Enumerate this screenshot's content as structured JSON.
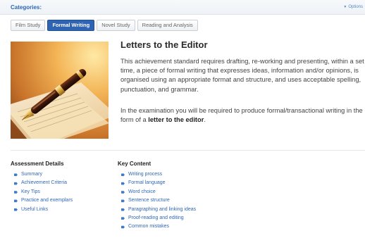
{
  "header": {
    "categories_label": "Categories:",
    "options_label": "Options"
  },
  "tabs": [
    {
      "label": "Film Study"
    },
    {
      "label": "Formal Writing",
      "active": true
    },
    {
      "label": "Novel Study"
    },
    {
      "label": "Reading and Analysis"
    }
  ],
  "article": {
    "title": "Letters to the Editor",
    "paragraph1": "This achievement standard requires drafting, re-working and presenting, within a set time, a piece of formal writing that expresses ideas, information and/or opinions, is organised using an appropriate format and structure, and uses acceptable spelling, punctuation, and grammar.",
    "paragraph2_before": "In the examination you will be required to produce formal/transactional writing in the form of a ",
    "paragraph2_bold": "letter to the editor",
    "paragraph2_after": "."
  },
  "assessment": {
    "heading": "Assessment Details",
    "items": [
      "Summary",
      "Achievement Criteria",
      "Key Tips",
      "Practice and exemplars",
      "Useful Links"
    ]
  },
  "key_content": {
    "heading": "Key Content",
    "items": [
      "Writing process",
      "Formal language",
      "Word choice",
      "Sentence structure",
      "Paragraphing and linking ideas",
      "Proof-reading and editing",
      "Common mistakes"
    ]
  },
  "colors": {
    "accent": "#2f63b3",
    "link": "#2f67b6"
  },
  "icons": {
    "photo": "pen-on-paper-photo",
    "bullet": "arrow-bullet-icon"
  }
}
